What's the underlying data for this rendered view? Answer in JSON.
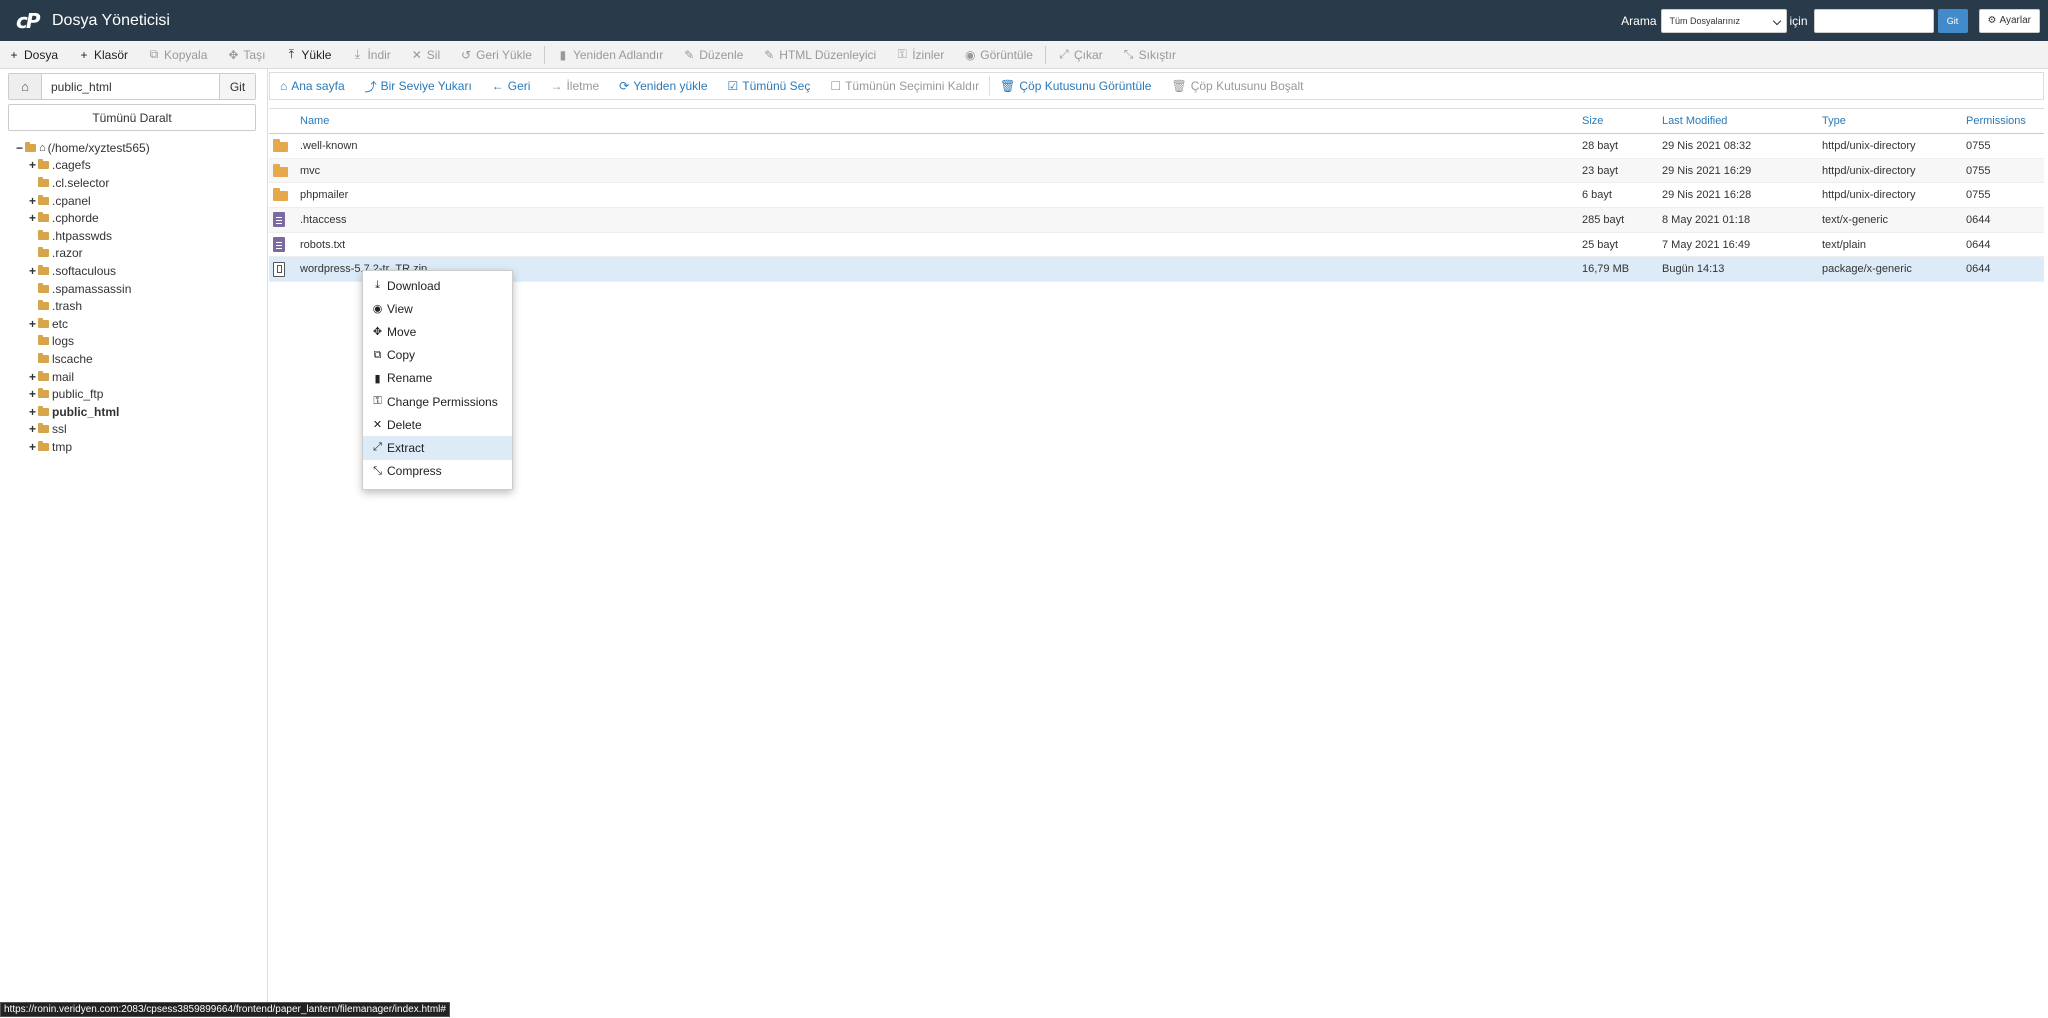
{
  "header": {
    "app_title": "Dosya Yöneticisi",
    "search_label": "Arama",
    "search_scope": "Tüm Dosyalarınız",
    "for_label": "için",
    "search_placeholder": "",
    "go_label": "Git",
    "settings_label": "Ayarlar"
  },
  "toolbar": [
    {
      "name": "new-file-button",
      "icon": "+",
      "label": "Dosya",
      "enabled": true
    },
    {
      "name": "new-folder-button",
      "icon": "+",
      "label": "Klasör",
      "enabled": true
    },
    {
      "name": "copy-button",
      "icon": "⧉",
      "label": "Kopyala",
      "enabled": false
    },
    {
      "name": "move-button",
      "icon": "✥",
      "label": "Taşı",
      "enabled": false
    },
    {
      "name": "upload-button",
      "icon": "⤒",
      "label": "Yükle",
      "enabled": true
    },
    {
      "name": "download-button",
      "icon": "⤓",
      "label": "İndir",
      "enabled": false
    },
    {
      "name": "delete-button",
      "icon": "✕",
      "label": "Sil",
      "enabled": false
    },
    {
      "name": "restore-button",
      "icon": "↺",
      "label": "Geri Yükle",
      "enabled": false,
      "sep_after": true
    },
    {
      "name": "rename-button",
      "icon": "▮",
      "label": "Yeniden Adlandır",
      "enabled": false
    },
    {
      "name": "edit-button",
      "icon": "✎",
      "label": "Düzenle",
      "enabled": false
    },
    {
      "name": "html-editor-button",
      "icon": "✎",
      "label": "HTML Düzenleyici",
      "enabled": false
    },
    {
      "name": "permissions-button",
      "icon": "⚿",
      "label": "İzinler",
      "enabled": false
    },
    {
      "name": "view-button",
      "icon": "◉",
      "label": "Görüntüle",
      "enabled": false,
      "sep_after": true
    },
    {
      "name": "extract-button",
      "icon": "⤢",
      "label": "Çıkar",
      "enabled": false
    },
    {
      "name": "compress-button",
      "icon": "⤡",
      "label": "Sıkıştır",
      "enabled": false
    }
  ],
  "left": {
    "path_value": "public_html",
    "path_go": "Git",
    "collapse_all": "Tümünü Daralt",
    "root_label": "(/home/xyztest565)",
    "tree": [
      {
        "label": ".cagefs",
        "expandable": true,
        "bold": false
      },
      {
        "label": ".cl.selector",
        "expandable": false,
        "bold": false
      },
      {
        "label": ".cpanel",
        "expandable": true,
        "bold": false
      },
      {
        "label": ".cphorde",
        "expandable": true,
        "bold": false
      },
      {
        "label": ".htpasswds",
        "expandable": false,
        "bold": false
      },
      {
        "label": ".razor",
        "expandable": false,
        "bold": false
      },
      {
        "label": ".softaculous",
        "expandable": true,
        "bold": false
      },
      {
        "label": ".spamassassin",
        "expandable": false,
        "bold": false
      },
      {
        "label": ".trash",
        "expandable": false,
        "bold": false
      },
      {
        "label": "etc",
        "expandable": true,
        "bold": false
      },
      {
        "label": "logs",
        "expandable": false,
        "bold": false
      },
      {
        "label": "lscache",
        "expandable": false,
        "bold": false
      },
      {
        "label": "mail",
        "expandable": true,
        "bold": false
      },
      {
        "label": "public_ftp",
        "expandable": true,
        "bold": false
      },
      {
        "label": "public_html",
        "expandable": true,
        "bold": true
      },
      {
        "label": "ssl",
        "expandable": true,
        "bold": false
      },
      {
        "label": "tmp",
        "expandable": true,
        "bold": false
      }
    ]
  },
  "nav": [
    {
      "name": "home-nav-button",
      "icon": "⌂",
      "label": "Ana sayfa",
      "enabled": true
    },
    {
      "name": "up-level-button",
      "icon": "⤴",
      "label": "Bir Seviye Yukarı",
      "enabled": true
    },
    {
      "name": "back-button",
      "icon": "←",
      "label": "Geri",
      "enabled": true
    },
    {
      "name": "forward-button",
      "icon": "→",
      "label": "İletme",
      "enabled": false
    },
    {
      "name": "reload-button",
      "icon": "⟳",
      "label": "Yeniden yükle",
      "enabled": true
    },
    {
      "name": "select-all-button",
      "icon": "☑",
      "label": "Tümünü Seç",
      "enabled": true
    },
    {
      "name": "unselect-all-button",
      "icon": "☐",
      "label": "Tümünün Seçimini Kaldır",
      "enabled": false,
      "sep_after": true
    },
    {
      "name": "view-trash-button",
      "icon": "🗑",
      "label": "Çöp Kutusunu Görüntüle",
      "enabled": true
    },
    {
      "name": "empty-trash-button",
      "icon": "🗑",
      "label": "Çöp Kutusunu Boşalt",
      "enabled": false
    }
  ],
  "table": {
    "headers": {
      "name": "Name",
      "size": "Size",
      "modified": "Last Modified",
      "type": "Type",
      "perms": "Permissions"
    },
    "rows": [
      {
        "icon": "folder",
        "name": ".well-known",
        "size": "28 bayt",
        "modified": "29 Nis 2021 08:32",
        "type": "httpd/unix-directory",
        "perms": "0755"
      },
      {
        "icon": "folder",
        "name": "mvc",
        "size": "23 bayt",
        "modified": "29 Nis 2021 16:29",
        "type": "httpd/unix-directory",
        "perms": "0755"
      },
      {
        "icon": "folder",
        "name": "phpmailer",
        "size": "6 bayt",
        "modified": "29 Nis 2021 16:28",
        "type": "httpd/unix-directory",
        "perms": "0755"
      },
      {
        "icon": "file",
        "name": ".htaccess",
        "size": "285 bayt",
        "modified": "8 May 2021 01:18",
        "type": "text/x-generic",
        "perms": "0644"
      },
      {
        "icon": "file",
        "name": "robots.txt",
        "size": "25 bayt",
        "modified": "7 May 2021 16:49",
        "type": "text/plain",
        "perms": "0644"
      },
      {
        "icon": "zip",
        "name": "wordpress-5.7.2-tr_TR.zip",
        "size": "16,79 MB",
        "modified": "Bugün 14:13",
        "type": "package/x-generic",
        "perms": "0644",
        "selected": true
      }
    ]
  },
  "context_menu": [
    {
      "name": "ctx-download",
      "icon": "⤓",
      "label": "Download"
    },
    {
      "name": "ctx-view",
      "icon": "◉",
      "label": "View"
    },
    {
      "name": "ctx-move",
      "icon": "✥",
      "label": "Move"
    },
    {
      "name": "ctx-copy",
      "icon": "⧉",
      "label": "Copy"
    },
    {
      "name": "ctx-rename",
      "icon": "▮",
      "label": "Rename"
    },
    {
      "name": "ctx-change-permissions",
      "icon": "⚿",
      "label": "Change Permissions"
    },
    {
      "name": "ctx-delete",
      "icon": "✕",
      "label": "Delete"
    },
    {
      "name": "ctx-extract",
      "icon": "⤢",
      "label": "Extract",
      "highlighted": true
    },
    {
      "name": "ctx-compress",
      "icon": "⤡",
      "label": "Compress"
    }
  ],
  "status_url": "https://ronin.veridyen.com:2083/cpsess3859899664/frontend/paper_lantern/filemanager/index.html#"
}
